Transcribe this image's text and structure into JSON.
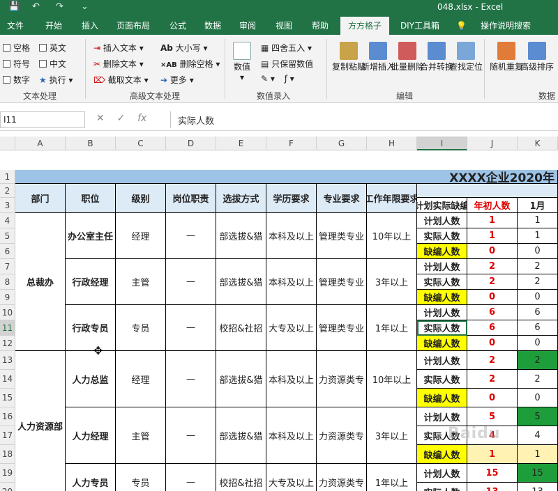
{
  "title_bar": {
    "title": "048.xlsx  -  Excel"
  },
  "tabs": [
    "文件",
    "开始",
    "插入",
    "页面布局",
    "公式",
    "数据",
    "审阅",
    "视图",
    "帮助",
    "方方格子",
    "DIY工具箱",
    "操作说明搜索"
  ],
  "ribbon": {
    "text_group": {
      "items": [
        "空格",
        "英文",
        "符号",
        "中文",
        "数字",
        "执行"
      ],
      "label": "文本处理"
    },
    "adv_group": {
      "items": [
        "插入文本",
        "删除文本",
        "截取文本",
        "大小写",
        "删除空格",
        "更多"
      ],
      "label": "高级文本处理"
    },
    "value_group": {
      "items": [
        "数值",
        "四舍五入",
        "只保留数值"
      ],
      "label": "数值录入"
    },
    "edit_group": {
      "items": [
        "复制粘贴",
        "新增插入",
        "批量删除",
        "合并转换",
        "查找定位"
      ],
      "label": "编辑"
    },
    "data_group": {
      "items": [
        "随机重复",
        "高级排序"
      ],
      "label": "数据"
    }
  },
  "formula_bar": {
    "name_box": "I11",
    "formula": "实际人数"
  },
  "columns": [
    "A",
    "B",
    "C",
    "D",
    "E",
    "F",
    "G",
    "H",
    "I",
    "J",
    "K"
  ],
  "sheet": {
    "banner": "XXXX企业2020年",
    "headers": {
      "dept": "部门",
      "pos": "职位",
      "level": "级别",
      "duty": "岗位职责",
      "method": "选拔方式",
      "edu": "学历要求",
      "major": "专业要求",
      "years": "工作年限要求",
      "status": "计划实际缺编",
      "start": "年初人数",
      "m1": "1月"
    },
    "depts": [
      "总裁办",
      "人力资源部"
    ],
    "positions": [
      "办公室主任",
      "行政经理",
      "行政专员",
      "人力总监",
      "人力经理",
      "人力专员"
    ],
    "levels": [
      "经理",
      "主管",
      "专员",
      "经理",
      "主管",
      "专员"
    ],
    "dash": "—",
    "methods": [
      "部选拔&猎",
      "部选拔&猎",
      "校招&社招",
      "部选拔&猎",
      "部选拔&猎",
      "校招&社招"
    ],
    "edus": [
      "本科及以上",
      "本科及以上",
      "大专及以上",
      "本科及以上",
      "本科及以上",
      "大专及以上"
    ],
    "majors": [
      "管理类专业",
      "管理类专业",
      "管理类专业",
      "力资源类专",
      "力资源类专",
      "力资源类专"
    ],
    "years": [
      "10年以上",
      "3年以上",
      "1年以上",
      "10年以上",
      "3年以上",
      "1年以上"
    ],
    "status_labels": [
      "计划人数",
      "实际人数",
      "缺编人数"
    ],
    "j_values": [
      "1",
      "1",
      "0",
      "2",
      "2",
      "0",
      "6",
      "6",
      "0",
      "2",
      "2",
      "0",
      "5",
      "4",
      "1",
      "15",
      "13"
    ],
    "k_values": [
      "1",
      "1",
      "0",
      "2",
      "2",
      "0",
      "6",
      "6",
      "0",
      "2",
      "2",
      "0",
      "5",
      "4",
      "1",
      "15",
      "13"
    ]
  },
  "colors": {
    "excel_green": "#217346",
    "yellow": "#ffff00",
    "green": "#1e9e3a",
    "red": "#e00000"
  }
}
